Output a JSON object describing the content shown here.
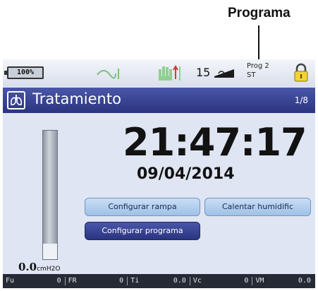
{
  "callout": {
    "label": "Programa"
  },
  "status": {
    "battery": "100%",
    "humidity_level": "15",
    "program_line1": "Prog 2",
    "program_line2": "ST"
  },
  "header": {
    "title": "Tratamiento",
    "page": "1/8"
  },
  "clock": {
    "time": "21:47:17",
    "date": "09/04/2014"
  },
  "pressure": {
    "value": "0.0",
    "unit": "cmH2O",
    "level_fraction": 0.12
  },
  "buttons": {
    "ramp": "Configurar rampa",
    "humidifier": "Calentar humidific",
    "program": "Configurar programa"
  },
  "metrics": [
    {
      "label": "Fu",
      "value": "0"
    },
    {
      "label": "FR",
      "value": "0"
    },
    {
      "label": "Ti",
      "value": "0.0"
    },
    {
      "label": "Vc",
      "value": "0"
    },
    {
      "label": "VM",
      "value": "0.0"
    }
  ],
  "colors": {
    "header": "#2f3a8f",
    "screen_bg": "#dfe5f2",
    "button_light": "#a9c8ea",
    "button_dark": "#2a3480",
    "metrics_bar": "#262a35"
  },
  "icons": [
    "battery-icon",
    "wave-icon",
    "hand-icon",
    "humidifier-icon",
    "lock-icon",
    "lungs-icon"
  ]
}
